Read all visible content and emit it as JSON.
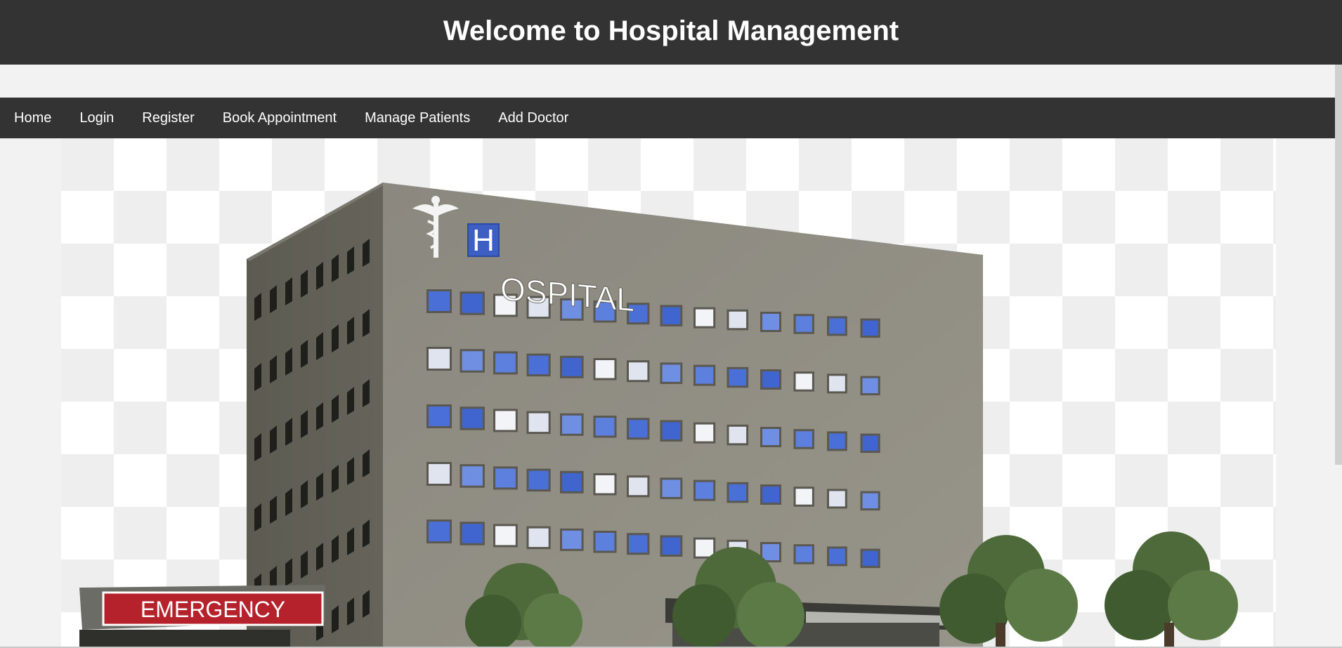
{
  "header": {
    "title": "Welcome to Hospital Management"
  },
  "nav": {
    "items": [
      {
        "label": "Home"
      },
      {
        "label": "Login"
      },
      {
        "label": "Register"
      },
      {
        "label": "Book Appointment"
      },
      {
        "label": "Manage Patients"
      },
      {
        "label": "Add Doctor"
      }
    ]
  },
  "hero": {
    "sign_initial": "H",
    "sign_rest": "OSPITAL",
    "emergency_label": "EMERGENCY"
  },
  "colors": {
    "header_bg": "#333333",
    "page_bg": "#f2f2f2",
    "header_text": "#ffffff",
    "building_front": "#8f8c85",
    "building_side": "#5f5e55",
    "window_blue": "#4a6fd6",
    "emergency_red": "#b5222b"
  }
}
